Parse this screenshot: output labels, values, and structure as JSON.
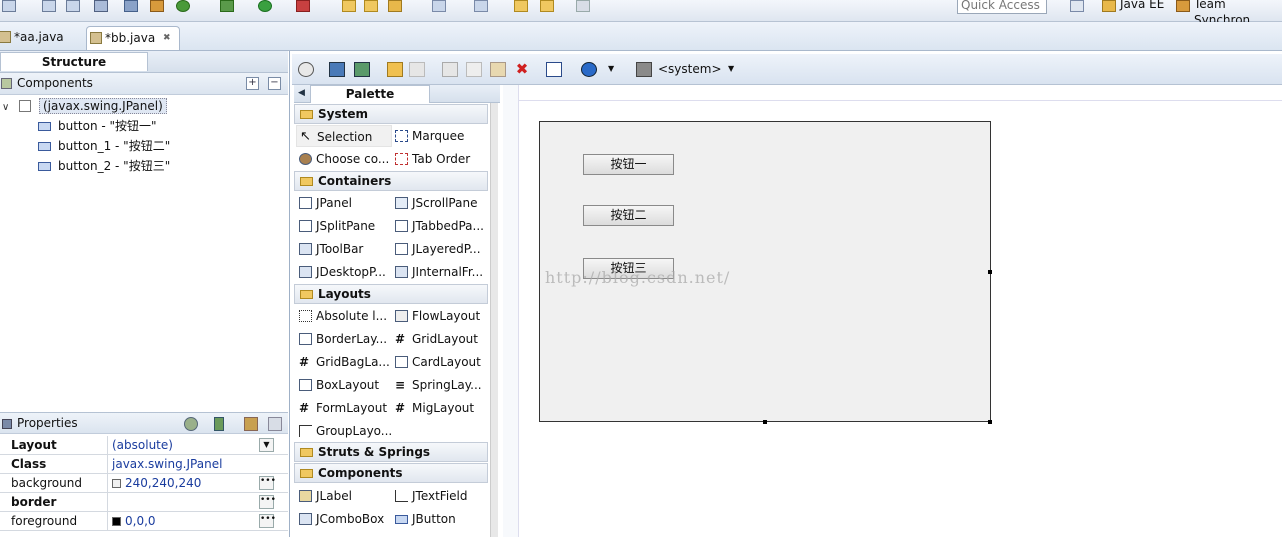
{
  "toolbar": {
    "quick_access_placeholder": "Quick Access",
    "perspective_java_ee": "Java EE",
    "perspective_team": "Team Synchron"
  },
  "editor_tabs": [
    {
      "label": "*aa.java"
    },
    {
      "label": "*bb.java",
      "close": "✖"
    }
  ],
  "structure": {
    "title": "Structure",
    "components_label": "Components",
    "tree_root": "(javax.swing.JPanel)",
    "tree_items": [
      "button - \"按钮一\"",
      "button_1 - \"按钮二\"",
      "button_2 - \"按钮三\""
    ]
  },
  "properties": {
    "title": "Properties",
    "rows": [
      {
        "key": "Layout",
        "value": "(absolute)"
      },
      {
        "key": "Class",
        "value": "javax.swing.JPanel"
      },
      {
        "key": "background",
        "value": "240,240,240",
        "swatch": "#f0f0f0"
      },
      {
        "key": "border",
        "value": ""
      },
      {
        "key": "foreground",
        "value": "0,0,0",
        "swatch": "#000000"
      }
    ]
  },
  "design_toolbar": {
    "system_label": "<system>"
  },
  "palette": {
    "title": "Palette",
    "categories": {
      "system": "System",
      "containers": "Containers",
      "layouts": "Layouts",
      "struts": "Struts & Springs",
      "components": "Components"
    },
    "system_items": [
      "Selection",
      "Marquee",
      "Choose co...",
      "Tab Order"
    ],
    "container_items": [
      "JPanel",
      "JScrollPane",
      "JSplitPane",
      "JTabbedPa...",
      "JToolBar",
      "JLayeredP...",
      "JDesktopP...",
      "JInternalFr..."
    ],
    "layout_items": [
      "Absolute l...",
      "FlowLayout",
      "BorderLay...",
      "GridLayout",
      "GridBagLa...",
      "CardLayout",
      "BoxLayout",
      "SpringLay...",
      "FormLayout",
      "MigLayout",
      "GroupLayo..."
    ],
    "component_items": [
      "JLabel",
      "JTextField",
      "JComboBox",
      "JButton"
    ]
  },
  "canvas": {
    "buttons": [
      "按钮一",
      "按钮二",
      "按钮三"
    ],
    "watermark": "http://blog.csdn.net/"
  },
  "colors": {
    "accent": "#1a3c9e",
    "panel_bg": "#f0f0f0",
    "chrome": "#dfe6f0"
  }
}
